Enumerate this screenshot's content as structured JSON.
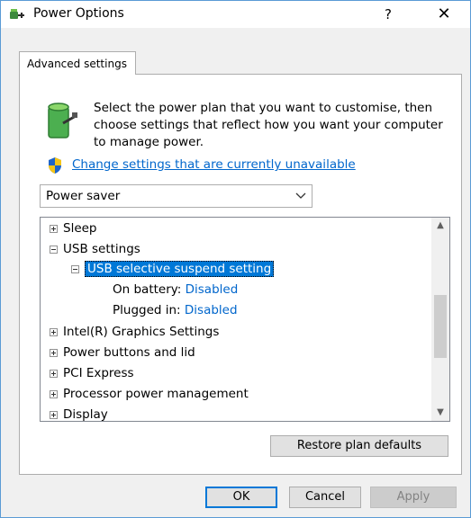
{
  "window": {
    "title": "Power Options",
    "help": "?",
    "close": "✕"
  },
  "tab": {
    "label": "Advanced settings"
  },
  "description": "Select the power plan that you want to customise, then choose settings that reflect how you want your computer to manage power.",
  "change_link": "Change settings that are currently unavailable",
  "plan_select": {
    "value": "Power saver"
  },
  "tree": {
    "sleep": "Sleep",
    "usb_settings": "USB settings",
    "usb_selective": "USB selective suspend setting",
    "on_battery_label": "On battery:",
    "on_battery_value": "Disabled",
    "plugged_in_label": "Plugged in:",
    "plugged_in_value": "Disabled",
    "intel_graphics": "Intel(R) Graphics Settings",
    "power_buttons": "Power buttons and lid",
    "pci_express": "PCI Express",
    "processor": "Processor power management",
    "display": "Display"
  },
  "buttons": {
    "restore": "Restore plan defaults",
    "ok": "OK",
    "cancel": "Cancel",
    "apply": "Apply"
  },
  "colors": {
    "accent": "#0078d7",
    "link": "#0066cc"
  }
}
